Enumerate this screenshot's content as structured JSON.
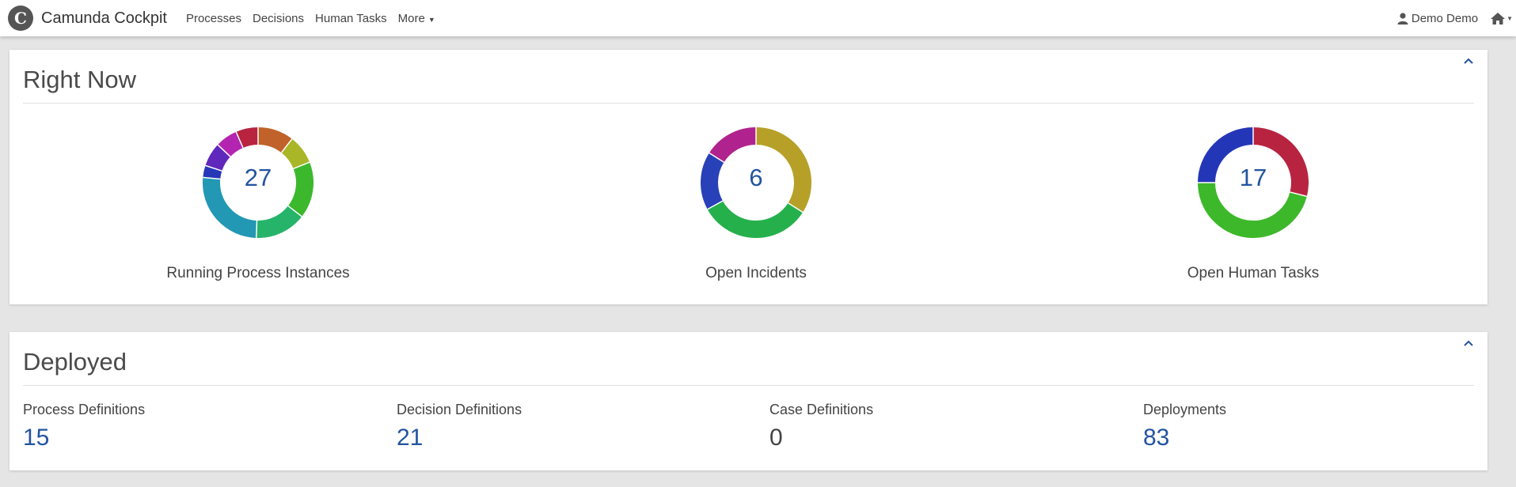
{
  "app": {
    "brand_logo_letter": "C",
    "brand_name": "Camunda Cockpit"
  },
  "nav": {
    "items": [
      {
        "label": "Processes"
      },
      {
        "label": "Decisions"
      },
      {
        "label": "Human Tasks"
      },
      {
        "label": "More"
      }
    ],
    "user_name": "Demo Demo"
  },
  "right_now": {
    "title": "Right Now",
    "donuts": [
      {
        "value": "27",
        "label": "Running Process Instances",
        "segments": [
          {
            "fraction": 0.105,
            "color": "#c0622a"
          },
          {
            "fraction": 0.085,
            "color": "#a9b628"
          },
          {
            "fraction": 0.165,
            "color": "#3cb82c"
          },
          {
            "fraction": 0.15,
            "color": "#25b469"
          },
          {
            "fraction": 0.26,
            "color": "#2298b4"
          },
          {
            "fraction": 0.035,
            "color": "#2637b8"
          },
          {
            "fraction": 0.07,
            "color": "#6027bd"
          },
          {
            "fraction": 0.065,
            "color": "#b325b0"
          },
          {
            "fraction": 0.065,
            "color": "#b82440"
          }
        ]
      },
      {
        "value": "6",
        "label": "Open Incidents",
        "segments": [
          {
            "fraction": 0.34,
            "color": "#b6a028"
          },
          {
            "fraction": 0.33,
            "color": "#25b04c"
          },
          {
            "fraction": 0.17,
            "color": "#2841b8"
          },
          {
            "fraction": 0.16,
            "color": "#b0238e"
          }
        ]
      },
      {
        "value": "17",
        "label": "Open Human Tasks",
        "segments": [
          {
            "fraction": 0.29,
            "color": "#b82440"
          },
          {
            "fraction": 0.46,
            "color": "#3db82a"
          },
          {
            "fraction": 0.25,
            "color": "#2436b8"
          }
        ]
      }
    ]
  },
  "deployed": {
    "title": "Deployed",
    "stats": [
      {
        "label": "Process Definitions",
        "value": "15"
      },
      {
        "label": "Decision Definitions",
        "value": "21"
      },
      {
        "label": "Case Definitions",
        "value": "0"
      },
      {
        "label": "Deployments",
        "value": "83"
      }
    ]
  },
  "colors": {
    "accent": "#2254a0",
    "background": "#e5e5e5",
    "panel": "#ffffff"
  }
}
